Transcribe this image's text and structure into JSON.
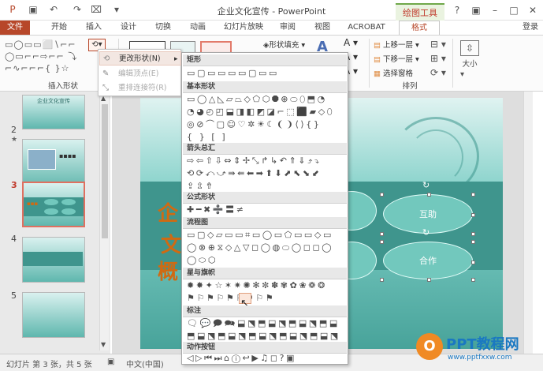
{
  "window": {
    "title": "企业文化宣传 - PowerPoint",
    "context_tab_group": "绘图工具",
    "help": "?",
    "login": "登录"
  },
  "tabs": [
    {
      "label": "文件"
    },
    {
      "label": "开始"
    },
    {
      "label": "插入"
    },
    {
      "label": "设计"
    },
    {
      "label": "切换"
    },
    {
      "label": "动画"
    },
    {
      "label": "幻灯片放映"
    },
    {
      "label": "审阅"
    },
    {
      "label": "视图"
    },
    {
      "label": "ACROBAT"
    },
    {
      "label": "格式"
    }
  ],
  "ribbon": {
    "insert_shapes_label": "插入形状",
    "shape_fill": "形状填充",
    "bring_forward": "上移一层",
    "send_backward": "下移一层",
    "selection_pane": "选择窗格",
    "arrange_label": "排列",
    "size_label": "大小"
  },
  "context_menu": {
    "items": [
      {
        "label": "更改形状(N)"
      },
      {
        "label": "编辑顶点(E)"
      },
      {
        "label": "重排连接符(R)"
      }
    ]
  },
  "gallery": {
    "categories": [
      {
        "label": "矩形",
        "rows": [
          "▭▢▭▭▭▭▢▭▭"
        ]
      },
      {
        "label": "基本形状",
        "rows": [
          "▭◯△◺▱⏢◇⬠⬡⯃⊕⬭⬯⬒◔",
          "◔◕◴◰⬓◨◧◩◪⌐⬚⬛▰◇⬯",
          "◎⊘⌒▢☺♡✲☀☾❨❩⟨⟩{}",
          "{ }  [ ]"
        ]
      },
      {
        "label": "箭头总汇",
        "rows": [
          "⇨⇦⇧⇩⇔⇕✢⤡↱↳↶⇑⇓⤴⤵",
          "⟲⟳⤺⤻⇛⇚⬅➡⬆⬇⬈⬉⬊⬋",
          "⇪⇫⇮"
        ]
      },
      {
        "label": "公式形状",
        "rows": [
          "✚━✖➗〓≠"
        ]
      },
      {
        "label": "流程图",
        "rows": [
          "▭▢◇▱▭▭⌗▭◯▭⬠▭▭◇▭",
          "◯⊗⊕⧖◇△▽◻◯◍⬭◯◻◻◯",
          "◯⬭⬡"
        ]
      },
      {
        "label": "星与旗帜",
        "rows": [
          "✹✸✦☆✶✷✺✻✼✽✾✿❀❁❂",
          "⚑⚐⚑⚐⚑⚐⚑⚐⚑"
        ]
      },
      {
        "label": "标注",
        "rows": [
          "🗨💬🗩🗪⬓⬔⬒⬓⬔⬒⬓⬔⬒⬓",
          "⬒⬓⬔⬒⬓⬔⬒⬓⬔⬒⬓⬔⬒⬓⬔"
        ]
      },
      {
        "label": "动作按钮",
        "rows": [
          "◁▷⏮⏭⌂ⓘ↩▶♫◻?▣"
        ]
      }
    ]
  },
  "thumbnails": [
    {
      "number": "2"
    },
    {
      "number": "3"
    },
    {
      "number": "4"
    },
    {
      "number": "5"
    }
  ],
  "slide": {
    "ellipse_top": "互助",
    "ellipse_bottom": "合作",
    "big_chars": [
      "企",
      "文",
      "概"
    ]
  },
  "status": {
    "slide_info": "幻灯片 第 3 张，共 5 张",
    "language": "中文(中国)"
  },
  "watermark": {
    "brand": "PPT教程网",
    "url": "www.pptfxxw.com"
  },
  "colors": {
    "accent": "#b7472a",
    "slide_teal": "#3f958d"
  }
}
